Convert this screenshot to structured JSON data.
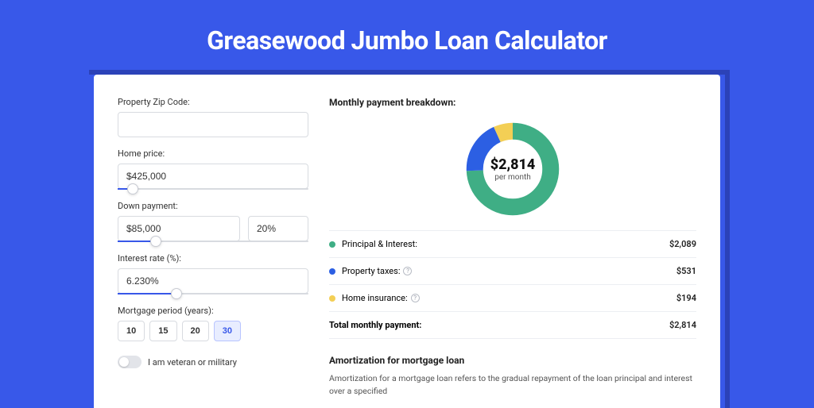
{
  "page_title": "Greasewood Jumbo Loan Calculator",
  "form": {
    "zip_label": "Property Zip Code:",
    "zip_value": "",
    "home_price_label": "Home price:",
    "home_price_value": "$425,000",
    "home_price_slider_pct": 8,
    "down_payment_label": "Down payment:",
    "down_payment_value": "$85,000",
    "down_payment_pct_value": "20%",
    "down_payment_slider_pct": 20,
    "interest_label": "Interest rate (%):",
    "interest_value": "6.230%",
    "interest_slider_pct": 31,
    "period_label": "Mortgage period (years):",
    "periods": [
      "10",
      "15",
      "20",
      "30"
    ],
    "period_active": "30",
    "veteran_label": "I am veteran or military"
  },
  "breakdown": {
    "title": "Monthly payment breakdown:",
    "center_big": "$2,814",
    "center_small": "per month",
    "items": [
      {
        "label": "Principal & Interest:",
        "value": "$2,089",
        "color": "#3fae85",
        "info": false
      },
      {
        "label": "Property taxes:",
        "value": "$531",
        "color": "#2c5fe3",
        "info": true
      },
      {
        "label": "Home insurance:",
        "value": "$194",
        "color": "#f3cf55",
        "info": true
      }
    ],
    "total_label": "Total monthly payment:",
    "total_value": "$2,814"
  },
  "chart_data": {
    "type": "pie",
    "title": "Monthly payment breakdown",
    "values": [
      2089,
      531,
      194
    ],
    "categories": [
      "Principal & Interest",
      "Property taxes",
      "Home insurance"
    ],
    "colors": [
      "#3fae85",
      "#2c5fe3",
      "#f3cf55"
    ],
    "total": 2814
  },
  "amort": {
    "title": "Amortization for mortgage loan",
    "text": "Amortization for a mortgage loan refers to the gradual repayment of the loan principal and interest over a specified"
  }
}
